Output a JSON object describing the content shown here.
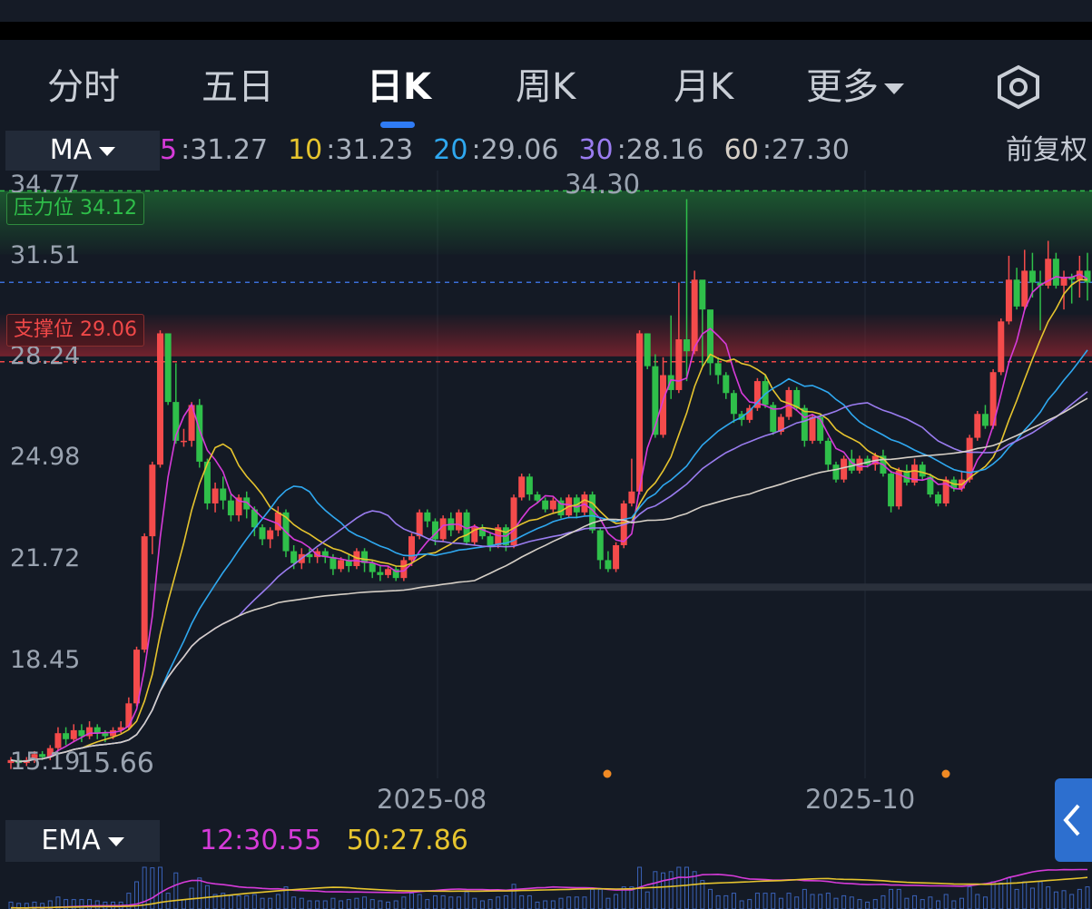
{
  "tabs": [
    {
      "label": "分时",
      "active": false
    },
    {
      "label": "五日",
      "active": false
    },
    {
      "label": "日K",
      "active": true
    },
    {
      "label": "周K",
      "active": false
    },
    {
      "label": "月K",
      "active": false
    },
    {
      "label": "更多",
      "active": false,
      "has_dropdown": true
    }
  ],
  "settings_icon": "settings-hexagon-icon",
  "main_indicator": {
    "label": "MA",
    "values": [
      {
        "period": "5",
        "value": ":31.27",
        "color": "#d63bd9"
      },
      {
        "period": "10",
        "value": ":31.23",
        "color": "#e6c42e"
      },
      {
        "period": "20",
        "value": ":29.06",
        "color": "#2fa8f0"
      },
      {
        "period": "30",
        "value": ":28.16",
        "color": "#9a7cf0"
      },
      {
        "period": "60",
        "value": ":27.30",
        "color": "#d6cfc6"
      }
    ],
    "adjust": "前复权"
  },
  "y_axis": [
    "34.77",
    "31.51",
    "28.24",
    "24.98",
    "21.72",
    "18.45",
    "15.19"
  ],
  "resistance": {
    "label": "压力位",
    "value": "34.12",
    "color": "#2fbf4a"
  },
  "support": {
    "label": "支撑位",
    "value": "29.06",
    "color": "#f04848"
  },
  "price_markers": {
    "high": "34.30",
    "low": "15.66"
  },
  "x_axis": [
    "2025-08",
    "2025-10"
  ],
  "sub_indicator": {
    "label": "EMA",
    "values": [
      {
        "text": "12:30.55",
        "color": "#d63bd9"
      },
      {
        "text": "50:27.86",
        "color": "#e6c42e"
      }
    ]
  },
  "colors": {
    "up": "#f44b4b",
    "down": "#2fbf4a",
    "background": "#141a25",
    "accent": "#2f7bf5"
  },
  "chart_data": {
    "type": "candlestick",
    "ylim": [
      15.19,
      34.77
    ],
    "candles": [
      [
        15.4,
        15.5,
        15.2,
        15.6
      ],
      [
        15.5,
        15.4,
        15.3,
        15.6
      ],
      [
        15.4,
        15.5,
        15.3,
        15.6
      ],
      [
        15.5,
        15.7,
        15.4,
        15.8
      ],
      [
        15.7,
        15.6,
        15.5,
        15.8
      ],
      [
        15.6,
        15.9,
        15.5,
        16.0
      ],
      [
        15.9,
        16.4,
        15.8,
        16.6
      ],
      [
        16.4,
        16.2,
        16.0,
        16.6
      ],
      [
        16.2,
        16.5,
        16.1,
        16.7
      ],
      [
        16.5,
        16.3,
        16.1,
        16.7
      ],
      [
        16.3,
        16.6,
        16.2,
        16.8
      ],
      [
        16.6,
        16.4,
        16.2,
        16.7
      ],
      [
        16.4,
        16.3,
        16.1,
        16.5
      ],
      [
        16.3,
        16.5,
        16.2,
        16.6
      ],
      [
        16.5,
        16.6,
        16.4,
        16.8
      ],
      [
        16.6,
        17.4,
        16.5,
        17.6
      ],
      [
        17.4,
        19.2,
        17.3,
        19.3
      ],
      [
        19.2,
        23.0,
        19.1,
        23.1
      ],
      [
        23.0,
        25.4,
        22.4,
        25.5
      ],
      [
        25.4,
        29.8,
        25.3,
        29.9
      ],
      [
        29.8,
        27.5,
        27.4,
        28.5
      ],
      [
        27.5,
        26.2,
        26.1,
        28.8
      ],
      [
        26.2,
        26.2,
        26.0,
        26.6
      ],
      [
        26.2,
        27.4,
        26.0,
        27.5
      ],
      [
        27.4,
        25.5,
        25.3,
        27.6
      ],
      [
        25.5,
        24.1,
        23.9,
        25.6
      ],
      [
        24.1,
        24.6,
        23.8,
        24.8
      ],
      [
        24.6,
        24.2,
        23.9,
        25.0
      ],
      [
        24.2,
        23.7,
        23.5,
        24.4
      ],
      [
        23.7,
        24.3,
        23.5,
        24.4
      ],
      [
        24.3,
        23.9,
        23.6,
        24.5
      ],
      [
        23.9,
        23.3,
        23.0,
        24.0
      ],
      [
        23.3,
        22.9,
        22.7,
        23.4
      ],
      [
        22.9,
        23.2,
        22.6,
        23.3
      ],
      [
        23.2,
        23.8,
        23.0,
        24.0
      ],
      [
        23.8,
        22.5,
        22.3,
        23.9
      ],
      [
        22.5,
        22.1,
        21.9,
        22.7
      ],
      [
        22.1,
        22.4,
        21.9,
        22.6
      ],
      [
        22.4,
        22.3,
        22.1,
        22.6
      ],
      [
        22.3,
        22.5,
        22.1,
        22.6
      ],
      [
        22.5,
        22.3,
        22.1,
        22.6
      ],
      [
        22.3,
        21.9,
        21.7,
        22.4
      ],
      [
        21.9,
        22.2,
        21.8,
        22.3
      ],
      [
        22.2,
        22.0,
        21.8,
        22.4
      ],
      [
        22.0,
        22.5,
        21.9,
        22.6
      ],
      [
        22.5,
        22.1,
        21.8,
        22.6
      ],
      [
        22.1,
        21.8,
        21.6,
        22.2
      ],
      [
        21.8,
        21.7,
        21.5,
        22.0
      ],
      [
        21.7,
        21.9,
        21.6,
        22.0
      ],
      [
        21.9,
        21.6,
        21.5,
        22.0
      ],
      [
        21.6,
        22.2,
        21.5,
        22.3
      ],
      [
        22.2,
        23.0,
        22.0,
        23.1
      ],
      [
        23.0,
        23.8,
        22.9,
        23.9
      ],
      [
        23.8,
        23.5,
        23.3,
        23.9
      ],
      [
        23.5,
        22.9,
        22.7,
        23.6
      ],
      [
        22.9,
        23.6,
        22.8,
        23.7
      ],
      [
        23.6,
        23.2,
        23.0,
        23.8
      ],
      [
        23.2,
        23.8,
        23.1,
        23.9
      ],
      [
        23.8,
        22.8,
        22.7,
        23.9
      ],
      [
        22.8,
        23.3,
        22.7,
        23.4
      ],
      [
        23.3,
        23.0,
        22.9,
        23.4
      ],
      [
        23.0,
        22.7,
        22.5,
        23.1
      ],
      [
        22.7,
        23.3,
        22.6,
        23.4
      ],
      [
        23.3,
        22.7,
        22.5,
        23.4
      ],
      [
        22.7,
        24.3,
        22.6,
        24.4
      ],
      [
        24.3,
        25.0,
        24.2,
        25.1
      ],
      [
        25.0,
        24.4,
        24.2,
        25.1
      ],
      [
        24.4,
        24.2,
        24.1,
        24.5
      ],
      [
        24.2,
        23.9,
        23.8,
        24.3
      ],
      [
        23.9,
        24.2,
        23.8,
        24.3
      ],
      [
        24.2,
        23.7,
        23.6,
        24.3
      ],
      [
        23.7,
        24.3,
        23.6,
        24.4
      ],
      [
        24.3,
        23.8,
        23.6,
        24.4
      ],
      [
        23.8,
        24.4,
        23.7,
        24.5
      ],
      [
        24.4,
        23.2,
        23.1,
        24.5
      ],
      [
        23.2,
        22.2,
        21.9,
        23.3
      ],
      [
        22.2,
        21.9,
        21.8,
        22.5
      ],
      [
        21.9,
        22.7,
        21.8,
        22.8
      ],
      [
        22.7,
        24.1,
        22.6,
        24.2
      ],
      [
        24.1,
        24.5,
        24.0,
        25.6
      ],
      [
        24.5,
        29.8,
        24.4,
        29.9
      ],
      [
        29.8,
        28.7,
        28.6,
        29.8
      ],
      [
        28.7,
        26.4,
        26.3,
        29.1
      ],
      [
        26.4,
        28.4,
        26.3,
        29.0
      ],
      [
        28.4,
        27.9,
        27.6,
        30.4
      ],
      [
        27.9,
        29.6,
        27.8,
        31.5
      ],
      [
        29.6,
        29.2,
        28.2,
        34.3
      ],
      [
        29.2,
        31.6,
        29.1,
        31.9
      ],
      [
        31.6,
        30.6,
        28.7,
        30.8
      ],
      [
        30.6,
        28.8,
        28.4,
        29.8
      ],
      [
        28.8,
        28.4,
        28.1,
        29.0
      ],
      [
        28.4,
        27.8,
        27.6,
        28.5
      ],
      [
        27.8,
        27.1,
        26.8,
        27.9
      ],
      [
        27.1,
        26.9,
        26.7,
        27.2
      ],
      [
        26.9,
        27.3,
        26.8,
        27.4
      ],
      [
        27.3,
        28.2,
        27.2,
        28.3
      ],
      [
        28.2,
        27.4,
        27.3,
        28.4
      ],
      [
        27.4,
        26.5,
        26.4,
        27.5
      ],
      [
        26.5,
        27.0,
        26.4,
        27.1
      ],
      [
        27.0,
        27.9,
        26.9,
        28.0
      ],
      [
        27.9,
        27.3,
        27.2,
        28.0
      ],
      [
        27.3,
        26.2,
        26.0,
        27.4
      ],
      [
        26.2,
        27.0,
        26.1,
        27.1
      ],
      [
        27.0,
        26.2,
        26.1,
        27.1
      ],
      [
        26.2,
        25.4,
        25.2,
        26.3
      ],
      [
        25.4,
        24.9,
        24.8,
        25.5
      ],
      [
        24.9,
        25.6,
        24.8,
        25.7
      ],
      [
        25.6,
        25.2,
        25.1,
        25.9
      ],
      [
        25.2,
        25.6,
        25.1,
        25.7
      ],
      [
        25.6,
        25.4,
        25.3,
        25.7
      ],
      [
        25.4,
        25.7,
        25.2,
        25.8
      ],
      [
        25.7,
        25.1,
        25.0,
        25.9
      ],
      [
        25.1,
        24.0,
        23.8,
        25.2
      ],
      [
        24.0,
        25.2,
        23.9,
        25.3
      ],
      [
        25.2,
        24.8,
        24.7,
        25.4
      ],
      [
        24.8,
        25.4,
        24.7,
        25.6
      ],
      [
        25.4,
        25.0,
        24.9,
        25.5
      ],
      [
        25.0,
        24.4,
        24.3,
        25.1
      ],
      [
        24.4,
        24.1,
        24.0,
        24.5
      ],
      [
        24.1,
        24.9,
        24.0,
        25.0
      ],
      [
        24.9,
        24.6,
        24.5,
        25.0
      ],
      [
        24.6,
        24.9,
        24.5,
        25.2
      ],
      [
        24.9,
        26.3,
        24.8,
        26.4
      ],
      [
        26.3,
        27.1,
        26.2,
        27.2
      ],
      [
        27.1,
        26.7,
        26.6,
        27.4
      ],
      [
        26.7,
        28.5,
        26.6,
        28.6
      ],
      [
        28.5,
        30.2,
        28.4,
        30.3
      ],
      [
        30.2,
        31.6,
        30.1,
        32.4
      ],
      [
        31.6,
        30.7,
        30.6,
        32.0
      ],
      [
        30.7,
        31.9,
        30.6,
        32.6
      ],
      [
        31.9,
        31.5,
        31.0,
        32.5
      ],
      [
        31.5,
        31.4,
        29.9,
        31.9
      ],
      [
        31.4,
        32.3,
        31.3,
        32.9
      ],
      [
        32.3,
        31.4,
        31.3,
        32.5
      ],
      [
        31.4,
        31.7,
        30.6,
        31.9
      ],
      [
        31.7,
        31.6,
        30.8,
        31.8
      ],
      [
        31.6,
        31.9,
        31.0,
        32.4
      ],
      [
        31.9,
        31.5,
        30.9,
        32.5
      ]
    ],
    "ma": {
      "5": "31.27",
      "10": "31.23",
      "20": "29.06",
      "30": "28.16",
      "60": "27.30"
    },
    "resistance": 34.12,
    "support": 29.06,
    "ma_mid_line": 31.51,
    "baseline": 21.72
  }
}
